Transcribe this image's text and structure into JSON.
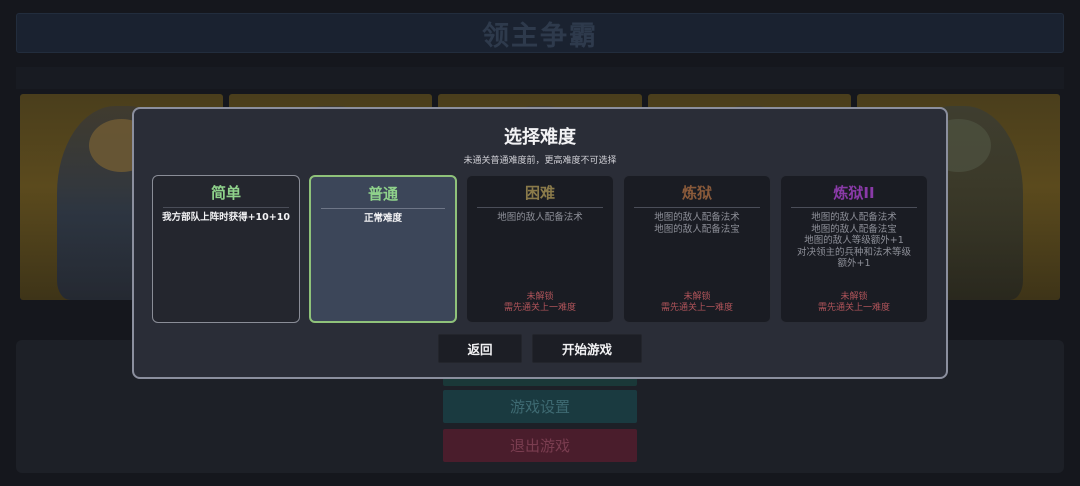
{
  "background": {
    "title": "领主争霸",
    "menu": {
      "settings_label": "游戏设置",
      "quit_label": "退出游戏"
    }
  },
  "dialog": {
    "title": "选择难度",
    "subtitle": "未通关普通难度前，更高难度不可选择",
    "difficulties": [
      {
        "name": "简单",
        "color": "#8fd28b",
        "state": "unlocked",
        "description": [
          "我方部队上阵时获得+10+10"
        ],
        "desc_color": "#f2f2f4"
      },
      {
        "name": "普通",
        "color": "#8fd28b",
        "state": "selected",
        "description": [
          "正常难度"
        ],
        "desc_color": "#f2f2f4"
      },
      {
        "name": "困难",
        "color": "#8a7a4a",
        "state": "locked",
        "description": [
          "地图的敌人配备法术"
        ],
        "desc_color": "#8e9099",
        "locked_label": "未解锁",
        "locked_hint": "需先通关上一难度"
      },
      {
        "name": "炼狱",
        "color": "#8a5a3a",
        "state": "locked",
        "description": [
          "地图的敌人配备法术",
          "地图的敌人配备法宝"
        ],
        "desc_color": "#8e9099",
        "locked_label": "未解锁",
        "locked_hint": "需先通关上一难度"
      },
      {
        "name": "炼狱II",
        "color": "#8a3aa8",
        "state": "locked",
        "description": [
          "地图的敌人配备法术",
          "地图的敌人配备法宝",
          "地图的敌人等级额外+1",
          "对决领主的兵种和法术等级",
          "额外+1"
        ],
        "desc_color": "#8e9099",
        "locked_label": "未解锁",
        "locked_hint": "需先通关上一难度"
      }
    ],
    "buttons": {
      "back_label": "返回",
      "start_label": "开始游戏"
    }
  }
}
